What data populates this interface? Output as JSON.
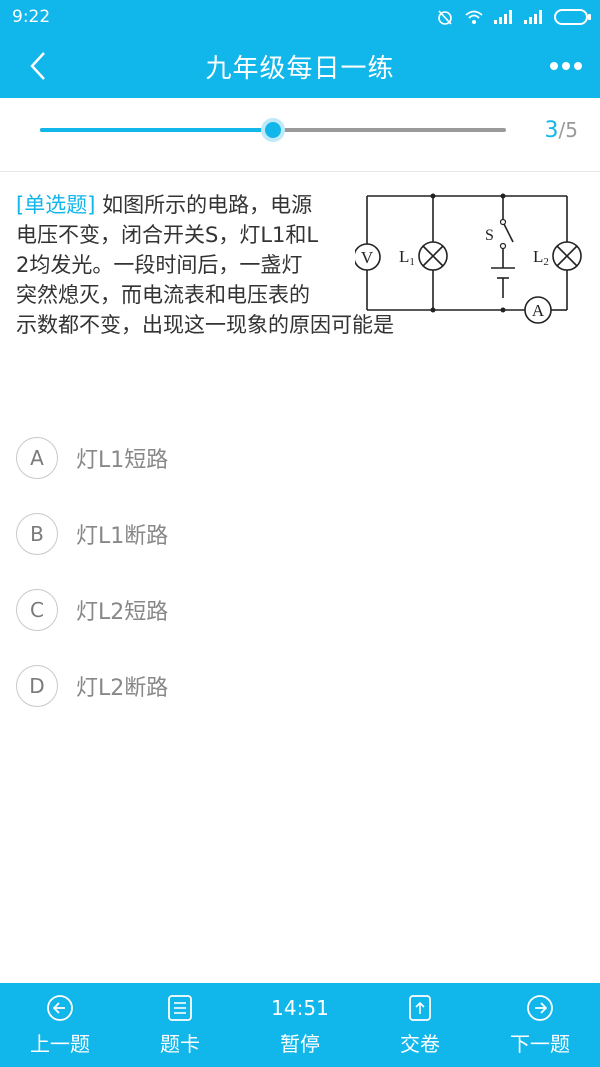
{
  "status": {
    "time": "9:22"
  },
  "nav": {
    "title": "九年级每日一练"
  },
  "progress": {
    "current": "3",
    "separator": "/",
    "total": "5",
    "fraction": 0.5
  },
  "question": {
    "tag": "[单选题]",
    "lines": [
      " 如图所示的电路，电源",
      "电压不变，闭合开关S，灯L1和L",
      "2均发光。一段时间后，一盏灯",
      "突然熄灭，而电流表和电压表的",
      "示数都不变，出现这一现象的原因可能是"
    ]
  },
  "circuit": {
    "voltmeter": "V",
    "ammeter": "A",
    "switch": "S",
    "lamp1": "L",
    "lamp1_sub": "1",
    "lamp2": "L",
    "lamp2_sub": "2"
  },
  "options": [
    {
      "letter": "A",
      "text": "灯L1短路"
    },
    {
      "letter": "B",
      "text": "灯L1断路"
    },
    {
      "letter": "C",
      "text": "灯L2短路"
    },
    {
      "letter": "D",
      "text": "灯L2断路"
    }
  ],
  "bottom": {
    "prev": "上一题",
    "card": "题卡",
    "timer": "14:51",
    "pause": "暂停",
    "submit": "交卷",
    "next": "下一题"
  },
  "colors": {
    "accent": "#11b6ea",
    "track": "#9a9a9a"
  }
}
